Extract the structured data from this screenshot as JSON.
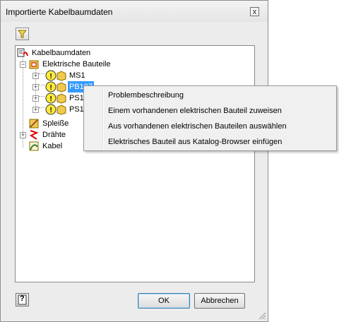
{
  "dialog": {
    "title": "Importierte Kabelbaumdaten",
    "close_glyph": "x"
  },
  "tree": {
    "root_label": "Kabelbaumdaten",
    "elektrisch_label": "Elektrische Bauteile",
    "parts": [
      "MS1",
      "PB107",
      "PS10",
      "PS1"
    ],
    "spleisse_label": "Spleiße",
    "draehte_label": "Drähte",
    "kabel_label": "Kabel"
  },
  "context_menu": {
    "items": [
      "Problembeschreibung",
      "Einem vorhandenen elektrischen Bauteil zuweisen",
      "Aus vorhandenen elektrischen Bauteilen auswählen",
      "Elektrisches Bauteil aus Katalog-Browser einfügen"
    ]
  },
  "buttons": {
    "ok_label": "OK",
    "cancel_label": "Abbrechen",
    "help_glyph": "?"
  },
  "colors": {
    "selection": "#3399ff",
    "warning_yellow": "#ffeb3b",
    "part_box": "#f2c94c"
  }
}
